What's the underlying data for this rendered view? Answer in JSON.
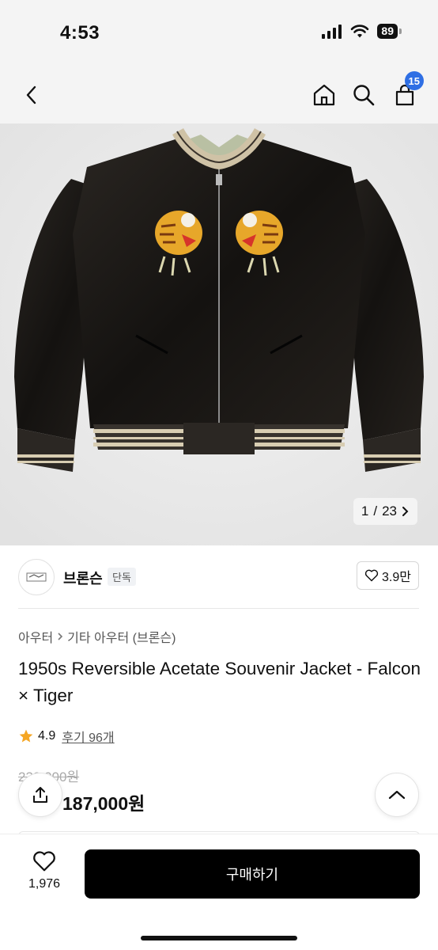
{
  "status_bar": {
    "time": "4:53",
    "battery": "89"
  },
  "nav": {
    "cart_count": "15"
  },
  "gallery": {
    "current": "1",
    "separator": "/",
    "total": "23"
  },
  "brand": {
    "name": "브론슨",
    "badge": "단독",
    "likes": "3.9만"
  },
  "breadcrumb": {
    "category": "아우터",
    "subcategory": "기타 아우터 (브론슨)"
  },
  "product": {
    "title": "1950s Reversible Acetate Souvenir Jacket - Falcon × Tiger",
    "rating": "4.9",
    "reviews": "후기 96개",
    "original_price": "230,000원",
    "sale_price": "187,000원"
  },
  "bottom_bar": {
    "wish_count": "1,976",
    "buy_label": "구매하기"
  },
  "colors": {
    "accent_blue": "#2f6fe4",
    "star": "#f5a623",
    "buy_button": "#000000"
  }
}
